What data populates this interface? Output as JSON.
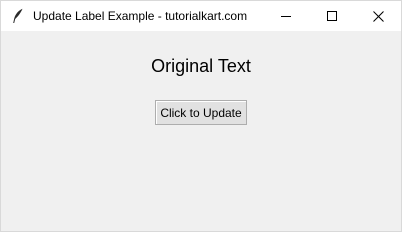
{
  "window": {
    "title": "Update Label Example - tutorialkart.com",
    "app_icon": "feather-icon"
  },
  "main": {
    "label_text": "Original Text",
    "button_label": "Click to Update"
  },
  "colors": {
    "background": "#f0f0f0",
    "titlebar": "#ffffff",
    "button": "#e1e1e1",
    "button_border": "#adadad"
  }
}
